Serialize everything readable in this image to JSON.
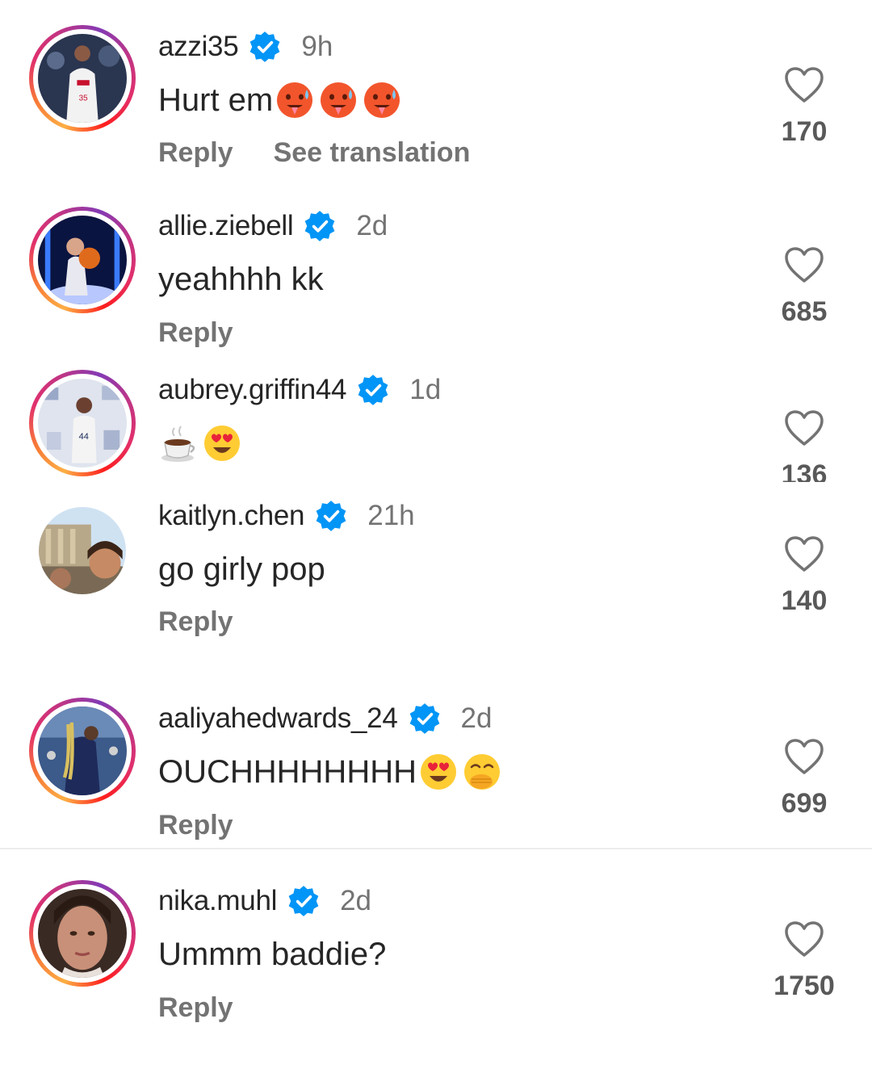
{
  "comments": [
    {
      "username": "azzi35",
      "time": "9h",
      "text": "Hurt em",
      "emojis": [
        "hot-face",
        "hot-face",
        "hot-face"
      ],
      "actions": [
        "Reply",
        "See translation"
      ],
      "likes": "170",
      "story_ring": true
    },
    {
      "username": "allie.ziebell",
      "time": "2d",
      "text": "yeahhhh kk",
      "emojis": [],
      "actions": [
        "Reply"
      ],
      "likes": "685",
      "story_ring": true
    },
    {
      "username": "aubrey.griffin44",
      "time": "1d",
      "text": "",
      "emojis": [
        "hot-beverage",
        "heart-eyes"
      ],
      "actions": [],
      "likes": "136",
      "story_ring": true
    },
    {
      "username": "kaitlyn.chen",
      "time": "21h",
      "text": "go girly pop",
      "emojis": [],
      "actions": [
        "Reply"
      ],
      "likes": "140",
      "story_ring": false
    },
    {
      "username": "aaliyahedwards_24",
      "time": "2d",
      "text": "OUCHHHHHHHH",
      "emojis": [
        "heart-eyes",
        "hand-over-mouth"
      ],
      "actions": [
        "Reply"
      ],
      "likes": "699",
      "story_ring": true
    },
    {
      "username": "nika.muhl",
      "time": "2d",
      "text": "Ummm baddie?",
      "emojis": [],
      "actions": [
        "Reply"
      ],
      "likes": "1750",
      "story_ring": true
    }
  ],
  "colors": {
    "verified_badge": "#0095f6",
    "secondary_text": "#737373",
    "primary_text": "#262626"
  }
}
